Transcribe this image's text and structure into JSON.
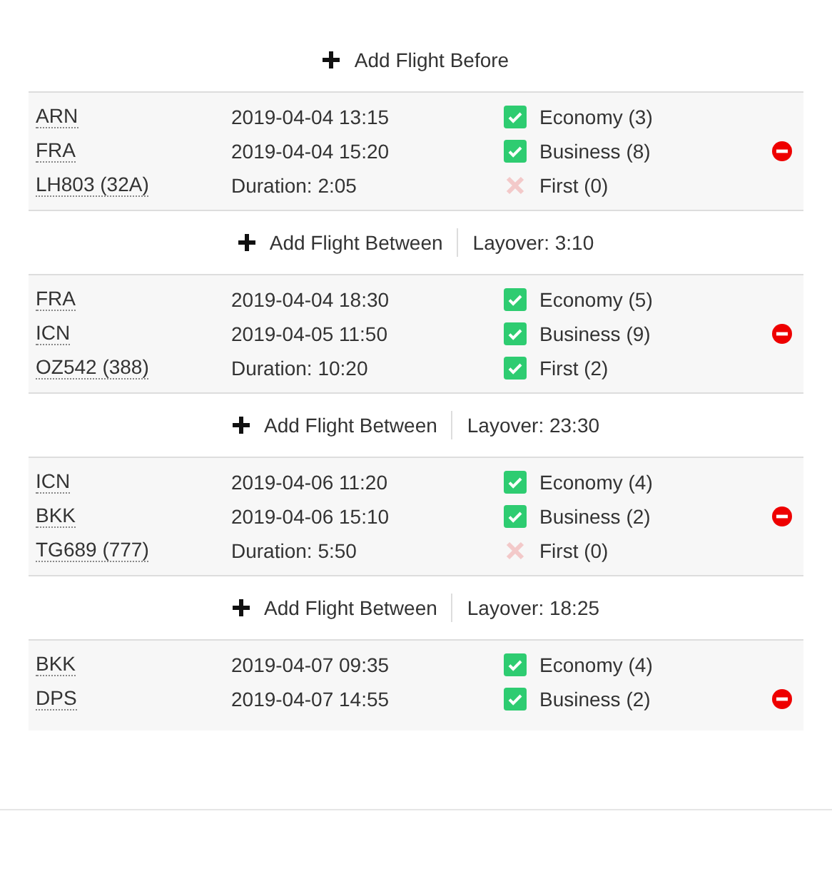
{
  "add_before": {
    "label": "Add Flight Before"
  },
  "legs": [
    {
      "flight": {
        "from": "ARN",
        "to": "FRA",
        "number": "LH803 (32A)",
        "departure": "2019-04-04 13:15",
        "arrival": "2019-04-04 15:20",
        "duration": "Duration: 2:05",
        "classes": [
          {
            "label": "Economy (3)",
            "checked": true
          },
          {
            "label": "Business (8)",
            "checked": true
          },
          {
            "label": "First (0)",
            "checked": false
          }
        ]
      },
      "gap": {
        "label": "Add Flight Between",
        "layover": "Layover: 3:10"
      }
    },
    {
      "flight": {
        "from": "FRA",
        "to": "ICN",
        "number": "OZ542 (388)",
        "departure": "2019-04-04 18:30",
        "arrival": "2019-04-05 11:50",
        "duration": "Duration: 10:20",
        "classes": [
          {
            "label": "Economy (5)",
            "checked": true
          },
          {
            "label": "Business (9)",
            "checked": true
          },
          {
            "label": "First (2)",
            "checked": true
          }
        ]
      },
      "gap": {
        "label": "Add Flight Between",
        "layover": "Layover: 23:30"
      }
    },
    {
      "flight": {
        "from": "ICN",
        "to": "BKK",
        "number": "TG689 (777)",
        "departure": "2019-04-06 11:20",
        "arrival": "2019-04-06 15:10",
        "duration": "Duration: 5:50",
        "classes": [
          {
            "label": "Economy (4)",
            "checked": true
          },
          {
            "label": "Business (2)",
            "checked": true
          },
          {
            "label": "First (0)",
            "checked": false
          }
        ]
      },
      "gap": {
        "label": "Add Flight Between",
        "layover": "Layover: 18:25"
      }
    },
    {
      "flight": {
        "from": "BKK",
        "to": "DPS",
        "departure": "2019-04-07 09:35",
        "arrival": "2019-04-07 14:55",
        "classes": [
          {
            "label": "Economy (4)",
            "checked": true
          },
          {
            "label": "Business (2)",
            "checked": true
          }
        ]
      }
    }
  ]
}
